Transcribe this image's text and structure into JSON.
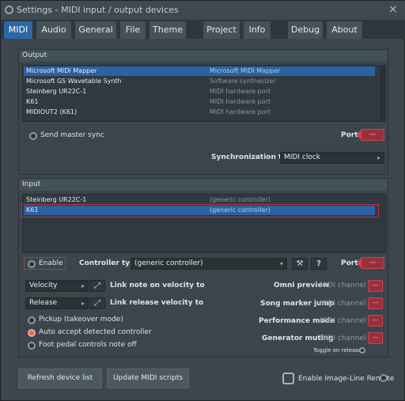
{
  "window": {
    "title": "Settings - MIDI input / output devices",
    "close": "×"
  },
  "tabs": [
    {
      "label": "MIDI"
    },
    {
      "label": "Audio"
    },
    {
      "label": "General"
    },
    {
      "label": "File"
    },
    {
      "label": "Theme"
    },
    {
      "label": "Project"
    },
    {
      "label": "Info"
    },
    {
      "label": "Debug"
    },
    {
      "label": "About"
    }
  ],
  "output": {
    "title": "Output",
    "devices": [
      {
        "name": "Microsoft MIDI Mapper",
        "type": "Microsoft MIDI Mapper"
      },
      {
        "name": "Microsoft GS Wavetable Synth",
        "type": "Software synthesizer"
      },
      {
        "name": "Steinberg UR22C-1",
        "type": "MIDI hardware port"
      },
      {
        "name": "K61",
        "type": "MIDI hardware port"
      },
      {
        "name": "MIDIOUT2 (K61)",
        "type": "MIDI hardware port"
      }
    ],
    "send_master_sync": "Send master sync",
    "port_label": "Port",
    "port_value": "---",
    "sync_type_label": "Synchronization type",
    "sync_type_value": "MIDI clock"
  },
  "input": {
    "title": "Input",
    "devices": [
      {
        "name": "Steinberg UR22C-1",
        "type": "(generic controller)"
      },
      {
        "name": "K61",
        "type": "(generic controller)"
      }
    ],
    "enable_label": "Enable",
    "controller_type_label": "Controller type",
    "controller_type_value": "(generic controller)",
    "help": "?",
    "port_label": "Port",
    "port_value": "---"
  },
  "options": {
    "velocity_select": "Velocity",
    "velocity_link": "Link note on velocity to",
    "release_select": "Release",
    "release_link": "Link release velocity to",
    "pickup": "Pickup (takeover mode)",
    "auto_accept": "Auto accept detected controller",
    "foot_pedal": "Foot pedal controls note off",
    "omni_preview": "Omni preview",
    "song_marker": "Song marker jump",
    "performance_mode": "Performance mode",
    "generator_muting": "Generator muting",
    "midi_channel": "MIDI channel",
    "channel_value": "---",
    "toggle_on_release": "Toggle on release"
  },
  "buttons": {
    "refresh": "Refresh device list",
    "update_scripts": "Update MIDI scripts",
    "image_line_remote": "Enable Image-Line Remote"
  },
  "colors": {
    "accent": "#2a68a8",
    "port": "#9a2f3b",
    "highlight_box": "#c0333f"
  }
}
